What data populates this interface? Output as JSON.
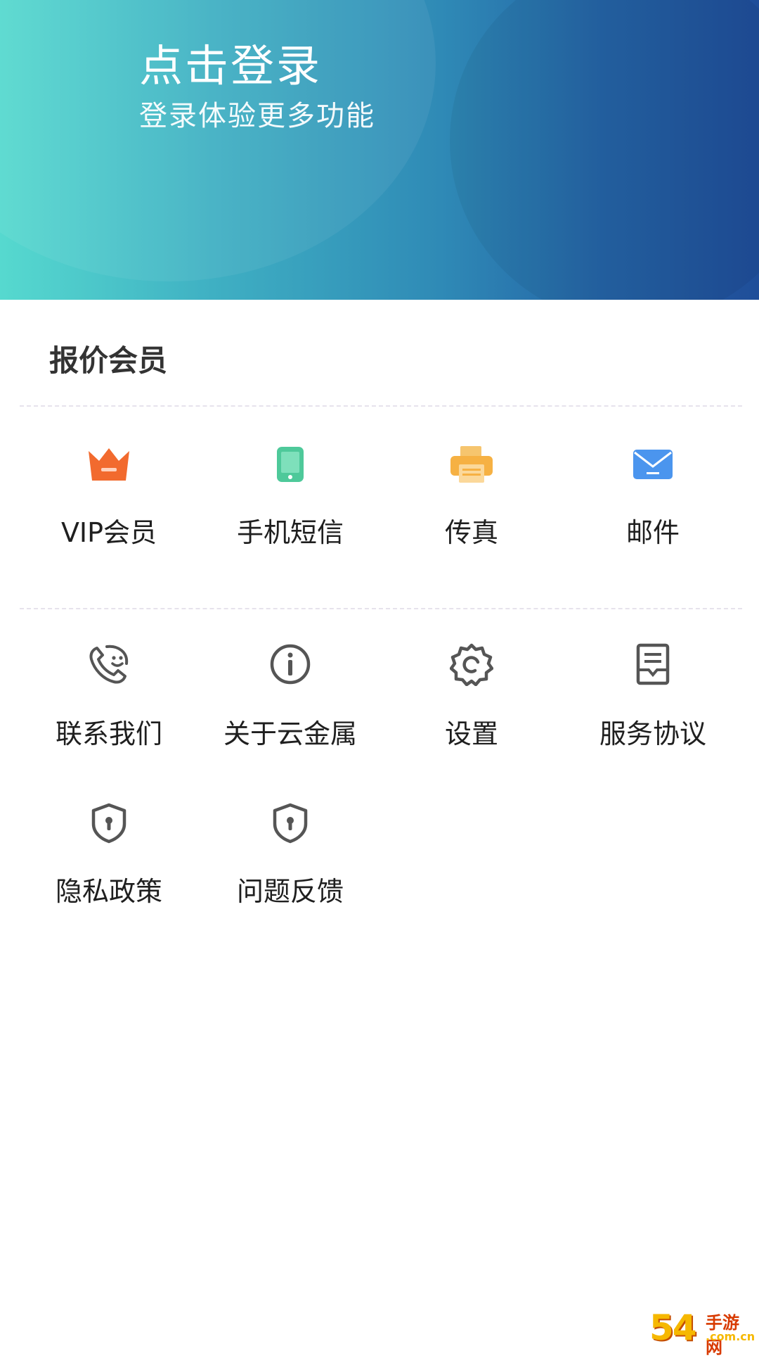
{
  "header": {
    "title": "点击登录",
    "subtitle": "登录体验更多功能"
  },
  "section": {
    "title": "报价会员"
  },
  "row1": [
    {
      "label": "VIP会员",
      "icon": "crown-icon",
      "color": "#f26a2e"
    },
    {
      "label": "手机短信",
      "icon": "phone-icon",
      "color": "#4ec99a"
    },
    {
      "label": "传真",
      "icon": "fax-icon",
      "color": "#f6b143"
    },
    {
      "label": "邮件",
      "icon": "mail-icon",
      "color": "#4b95ee"
    }
  ],
  "row2": [
    {
      "label": "联系我们",
      "icon": "contact-phone-icon"
    },
    {
      "label": "关于云金属",
      "icon": "info-icon"
    },
    {
      "label": "设置",
      "icon": "gear-icon"
    },
    {
      "label": "服务协议",
      "icon": "document-icon"
    }
  ],
  "row3": [
    {
      "label": "隐私政策",
      "icon": "shield-lock-icon"
    },
    {
      "label": "问题反馈",
      "icon": "shield-lock-icon"
    }
  ],
  "colors": {
    "header_start": "#56d9cf",
    "header_end": "#1f4e99",
    "icon_gray": "#555555"
  },
  "watermark": {
    "number": "54",
    "text": "手游网",
    "domain": ".com.cn"
  }
}
